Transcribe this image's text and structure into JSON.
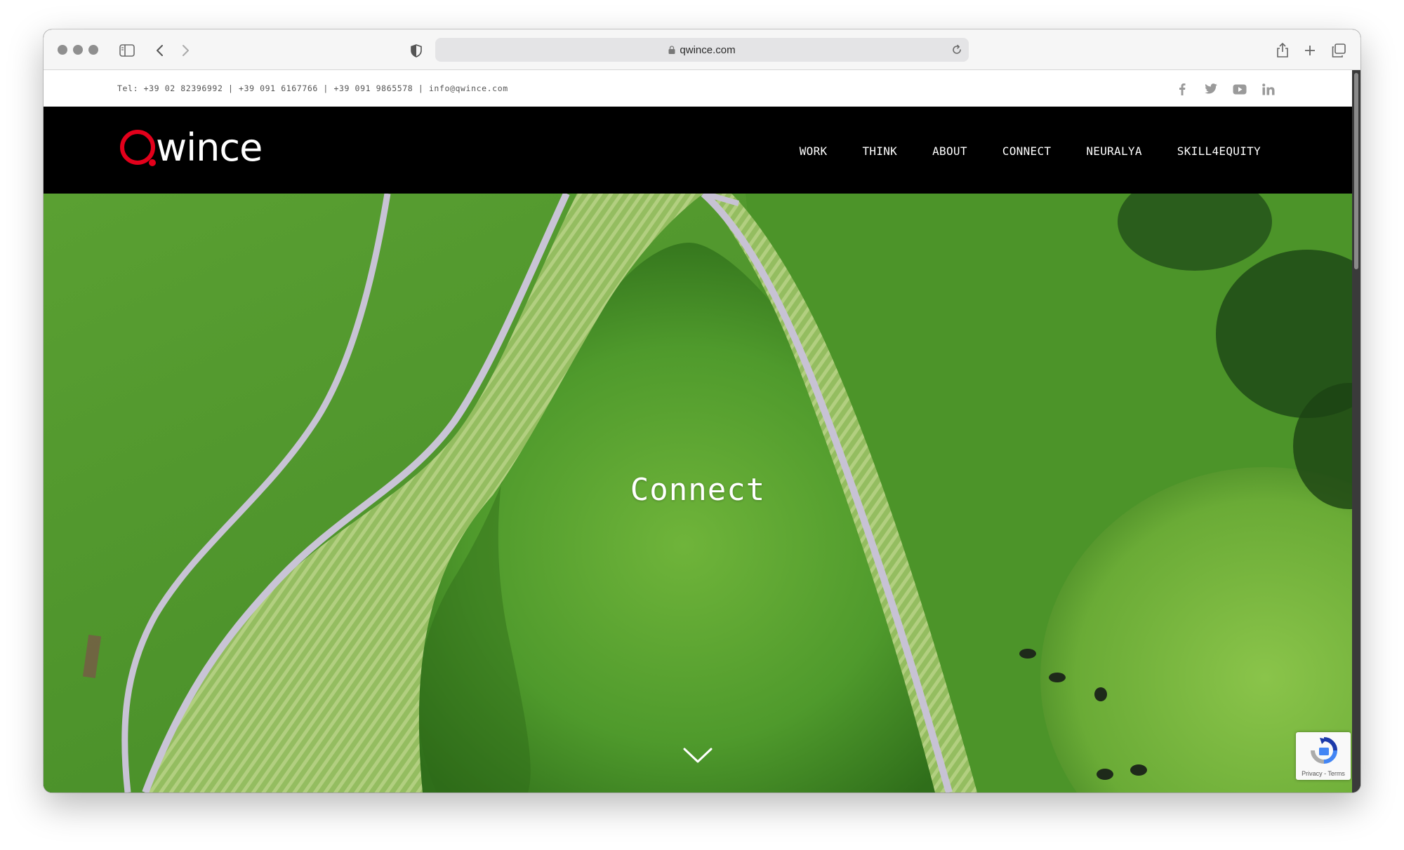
{
  "browser": {
    "url": "qwince.com",
    "icons": {
      "sidebar": "sidebar-icon",
      "back": "chevron-left-icon",
      "forward": "chevron-right-icon",
      "shield": "shield-icon",
      "lock": "lock-icon",
      "reload": "reload-icon",
      "share": "share-icon",
      "new_tab": "plus-icon",
      "tabs": "tabs-overview-icon"
    }
  },
  "topbar": {
    "contact": "Tel: +39 02 82396992 | +39 091 6167766 | +39 091 9865578 | info@qwince.com",
    "social": [
      "facebook-icon",
      "twitter-icon",
      "youtube-icon",
      "linkedin-icon"
    ]
  },
  "header": {
    "logo_text": "wince",
    "nav": [
      "WORK",
      "THINK",
      "ABOUT",
      "CONNECT",
      "NEURALYA",
      "SKILL4EQUITY"
    ]
  },
  "hero": {
    "title": "Connect",
    "scroll_icon": "chevron-down-icon"
  },
  "recaptcha": {
    "label": "Privacy - Terms"
  },
  "colors": {
    "brand_red": "#e3001b",
    "nav_background": "#000000",
    "grass": "#4e8d2a"
  }
}
